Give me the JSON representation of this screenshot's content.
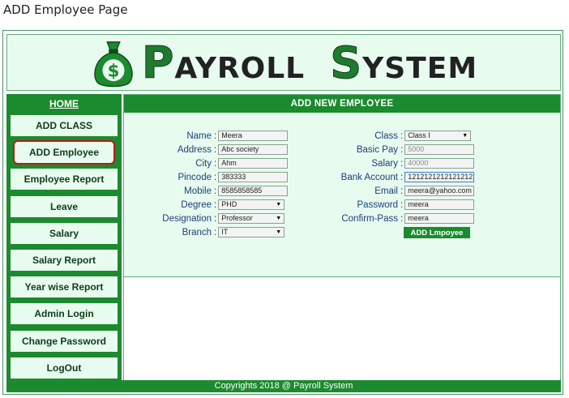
{
  "page_caption": "ADD Employee Page",
  "logo": {
    "big1": "P",
    "small1": "AYROLL",
    "big2": "S",
    "small2": "YSTEM",
    "icon": "money-bag-icon"
  },
  "sidebar": {
    "home": "HOME",
    "items": [
      {
        "label": "ADD CLASS"
      },
      {
        "label": "ADD Employee"
      },
      {
        "label": "Employee Report"
      },
      {
        "label": "Leave"
      },
      {
        "label": "Salary"
      },
      {
        "label": "Salary Report"
      },
      {
        "label": "Year wise Report"
      },
      {
        "label": "Admin Login"
      },
      {
        "label": "Change Password"
      },
      {
        "label": "LogOut"
      }
    ]
  },
  "main": {
    "title": "ADD NEW EMPLOYEE",
    "left_fields": [
      {
        "label": "Name",
        "value": "Meera"
      },
      {
        "label": "Address",
        "value": "Abc society"
      },
      {
        "label": "City",
        "value": "Ahm"
      },
      {
        "label": "Pincode",
        "value": "383333"
      },
      {
        "label": "Mobile",
        "value": "8585858585"
      },
      {
        "label": "Degree",
        "value": "PHD"
      },
      {
        "label": "Designation",
        "value": "Professor"
      },
      {
        "label": "Branch",
        "value": "IT"
      }
    ],
    "right_fields": [
      {
        "label": "Class",
        "value": "Class I"
      },
      {
        "label": "Basic Pay",
        "value": "5000"
      },
      {
        "label": "Salary",
        "value": "40000"
      },
      {
        "label": "Bank Account",
        "value": "1212121212121212"
      },
      {
        "label": "Email",
        "value": "meera@yahoo.com"
      },
      {
        "label": "Password",
        "value": "meera"
      },
      {
        "label": "Confirm-Pass",
        "value": "meera"
      }
    ],
    "submit": "ADD Lmpoyee"
  },
  "footer": "Copyrights 2018 @ Payroll System",
  "colors": {
    "accent": "#1c8a2e",
    "panel": "#e8fbef",
    "active_border": "#c0171d",
    "label": "#1d3f79"
  }
}
